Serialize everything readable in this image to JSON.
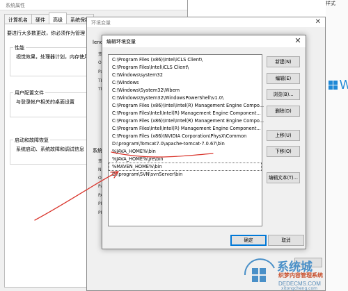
{
  "system_properties": {
    "title": "系统属性",
    "tabs": [
      "计算机名",
      "硬件",
      "高级",
      "系统保护"
    ],
    "active_tab": "高级",
    "admin_note": "要进行大多数更改，你必须作为管理",
    "performance": {
      "title": "性能",
      "text": "视觉效果，处理器计划，内存使用"
    },
    "user_profile": {
      "title": "用户配置文件",
      "text": "与登录帐户相关的桌面设置"
    },
    "startup_recovery": {
      "title": "启动和故障恢复",
      "text": "系统启动、系统故障和调试信息"
    }
  },
  "env_vars_window": {
    "title": "环境变量",
    "user_label": "lenc",
    "user_stub": [
      "变",
      "O",
      "Pa",
      "TE",
      "TN"
    ],
    "system_label": "系统",
    "system_stub": [
      "变",
      "N",
      "O",
      "Pa",
      "PA",
      "PF",
      "PF"
    ]
  },
  "edit_dialog": {
    "title": "编辑环境变量",
    "items": [
      "C:\\Program Files (x86)\\Intel\\iCLS Client\\",
      "C:\\Program Files\\Intel\\iCLS Client\\",
      "C:\\Windows\\system32",
      "C:\\Windows",
      "C:\\Windows\\System32\\Wbem",
      "C:\\Windows\\System32\\WindowsPowerShell\\v1.0\\",
      "C:\\Program Files (x86)\\Intel\\Intel(R) Management Engine Compo...",
      "C:\\Program Files\\Intel\\Intel(R) Management Engine Component...",
      "C:\\Program Files (x86)\\Intel\\Intel(R) Management Engine Compo...",
      "C:\\Program Files\\Intel\\Intel(R) Management Engine Component...",
      "C:\\Program Files (x86)\\NVIDIA Corporation\\PhysX\\Common",
      "D:\\program\\Tomcat7.0\\apache-tomcat-7.0.67\\bin",
      "%JAVA_HOME%\\bin",
      "%JAVA_HOME%\\jre\\bin",
      "%MAVEN_HOME%\\bin",
      "D:\\program\\SVN\\svnServer\\bin"
    ],
    "selected_index": 14,
    "buttons": {
      "new": "新建(N)",
      "edit": "编辑(E)",
      "browse": "浏览(B)...",
      "delete": "删除(D)",
      "move_up": "上移(U)",
      "move_down": "下移(O)",
      "edit_text": "编辑文本(T)..."
    },
    "ok": "确定",
    "cancel": "取消"
  },
  "right_strip": {
    "top_label": "样式",
    "logo_text": "W"
  },
  "watermark": {
    "brand": "系统城",
    "line1": "织梦内容管理系统",
    "line2": "DEDECMS.COM",
    "line3": "xitongcheng.com"
  },
  "colors": {
    "accent": "#0078d7",
    "annotation": "#d9342b",
    "watermark_blue": "#4a90c8"
  }
}
